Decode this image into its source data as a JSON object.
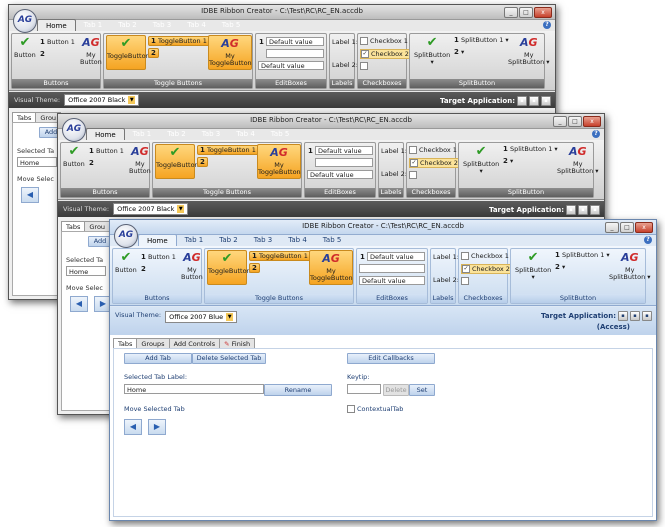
{
  "app_title": "IDBE Ribbon Creator - C:\\Test\\RC\\RC_EN.accdb",
  "logo_text": "AG",
  "window_buttons": {
    "minimize": "_",
    "maximize": "□",
    "close": "x"
  },
  "help_glyph": "?",
  "ribbon_tabs": [
    "Home",
    "Tab 1",
    "Tab 2",
    "Tab 3",
    "Tab 4",
    "Tab 5"
  ],
  "groups": {
    "buttons": {
      "label": "Buttons",
      "button_label": "Button",
      "button1_num": "1",
      "button1_label": "Button 1",
      "button2_num": "2",
      "my_button_line1": "My",
      "my_button_line2": "Button"
    },
    "toggle": {
      "label": "Toggle Buttons",
      "toggle_label": "ToggleButton",
      "toggle1_num": "1",
      "toggle1_label": "ToggleButton 1",
      "toggle2_num": "2",
      "my_toggle_line1": "My",
      "my_toggle_line2": "ToggleButton"
    },
    "editboxes": {
      "label": "EditBoxes",
      "num": "1",
      "default_value": "Default value"
    },
    "labels": {
      "label": "Labels",
      "label1": "Label 1:",
      "label2": "Label 2:"
    },
    "checkboxes": {
      "label": "Checkboxes",
      "checkbox1": "Checkbox 1",
      "checkbox2": "Checkbox 2",
      "checked_glyph": "✓"
    },
    "splitbutton": {
      "label": "SplitButton",
      "split_label": "SplitButton",
      "split1_num": "1",
      "split1_label": "SplitButton 1",
      "split2_num": "2",
      "my_split_line1": "My",
      "my_split_line2": "SplitButton",
      "dropdown_glyph": "▾"
    }
  },
  "theme": {
    "label": "Visual Theme:",
    "dark_value": "Office 2007 Black",
    "blue_value": "Office 2007 Blue"
  },
  "target": {
    "label": "Target Application:",
    "app": "(Access)"
  },
  "page_tabs": [
    "Tabs",
    "Groups",
    "Add Controls",
    "Finish"
  ],
  "page_tabs_truncated": {
    "groups": "Grou",
    "add": "Add",
    "selected_label": "Selected Ta",
    "move": "Move Selec"
  },
  "tabs_page": {
    "add_tab": "Add Tab",
    "delete_selected_tab": "Delete Selected Tab",
    "edit_callbacks": "Edit Callbacks",
    "selected_tab_label": "Selected Tab Label:",
    "selected_tab_value": "Home",
    "rename": "Rename",
    "keytip": "Keytip:",
    "delete": "Delete",
    "set": "Set",
    "move_selected_tab": "Move Selected Tab",
    "contextual_tab": "ContextualTab",
    "move_left": "◀",
    "move_right": "▶"
  },
  "icons": [
    "check-icon",
    "ag-logo-icon",
    "help-icon",
    "dropdown-arrow-icon",
    "arrow-left-icon",
    "arrow-right-icon"
  ],
  "colors": {
    "dark_group_label": "#6e6e6e",
    "toggle_orange": "#f5a422",
    "blue_accent": "#1f3f73",
    "check_green": "#2e9b25"
  }
}
